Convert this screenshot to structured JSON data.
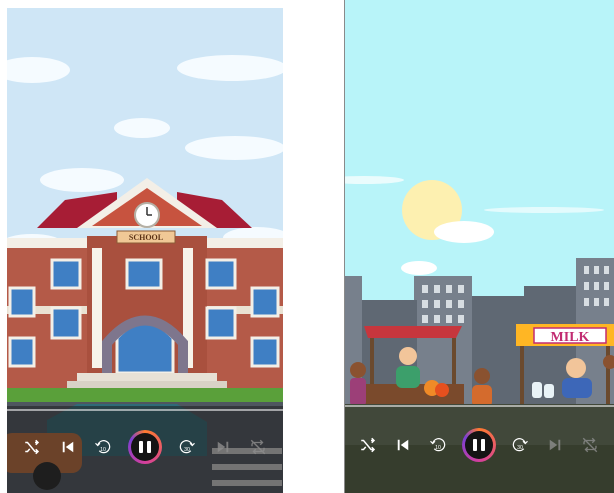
{
  "left_panel": {
    "school_sign": "SCHOOL",
    "controls": {
      "shuffle_icon": "shuffle-icon",
      "previous_icon": "skip-previous-icon",
      "rewind_label": "10",
      "forward_label": "30",
      "next_icon": "skip-next-icon",
      "repeat_icon": "repeat-off-icon"
    }
  },
  "right_panel": {
    "milk_sign": "MILK",
    "controls": {
      "shuffle_icon": "shuffle-icon",
      "previous_icon": "skip-previous-icon",
      "rewind_label": "10",
      "forward_label": "30",
      "next_icon": "skip-next-icon",
      "repeat_icon": "repeat-off-icon"
    }
  },
  "colors": {
    "accent_start": "#ff7a2f",
    "accent_mid": "#d43f9c",
    "accent_end": "#7a3fd4",
    "player_overlay": "#1f1f1f"
  }
}
